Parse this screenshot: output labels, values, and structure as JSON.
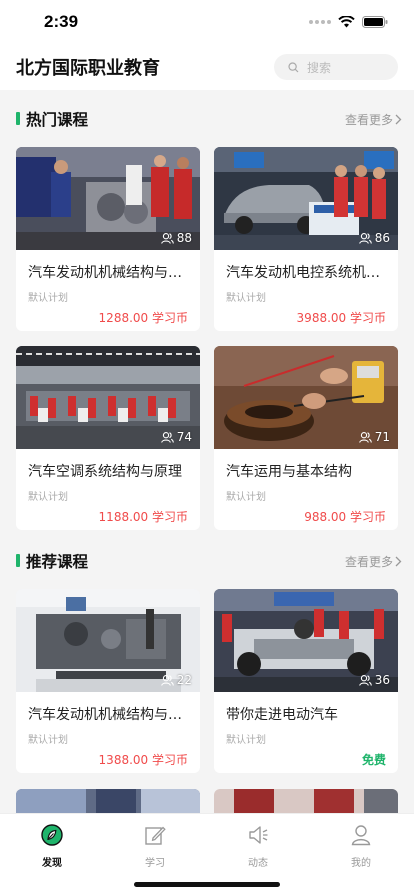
{
  "status_bar": {
    "time": "2:39"
  },
  "header": {
    "title": "北方国际职业教育",
    "search_placeholder": "搜索"
  },
  "hot_section": {
    "title": "热门课程",
    "more": "查看更多",
    "courses": [
      {
        "title": "汽车发动机机械结构与…",
        "plan": "默认计划",
        "price": "1288.00 学习币",
        "views": "88"
      },
      {
        "title": "汽车发动机电控系统机…",
        "plan": "默认计划",
        "price": "3988.00 学习币",
        "views": "86"
      },
      {
        "title": "汽车空调系统结构与原理",
        "plan": "默认计划",
        "price": "1188.00 学习币",
        "views": "74"
      },
      {
        "title": "汽车运用与基本结构",
        "plan": "默认计划",
        "price": "988.00 学习币",
        "views": "71"
      }
    ]
  },
  "recommend_section": {
    "title": "推荐课程",
    "more": "查看更多",
    "courses": [
      {
        "title": "汽车发动机机械结构与…",
        "plan": "默认计划",
        "price": "1388.00 学习币",
        "views": "22"
      },
      {
        "title": "带你走进电动汽车",
        "plan": "默认计划",
        "price": "免费",
        "views": "36"
      }
    ]
  },
  "tabbar": {
    "tabs": [
      {
        "label": "发现",
        "icon": "compass-icon",
        "active": true
      },
      {
        "label": "学习",
        "icon": "edit-icon",
        "active": false
      },
      {
        "label": "动态",
        "icon": "speaker-icon",
        "active": false
      },
      {
        "label": "我的",
        "icon": "user-icon",
        "active": false
      }
    ]
  },
  "colors": {
    "accent": "#1fb46b",
    "price": "#f04b4b"
  }
}
